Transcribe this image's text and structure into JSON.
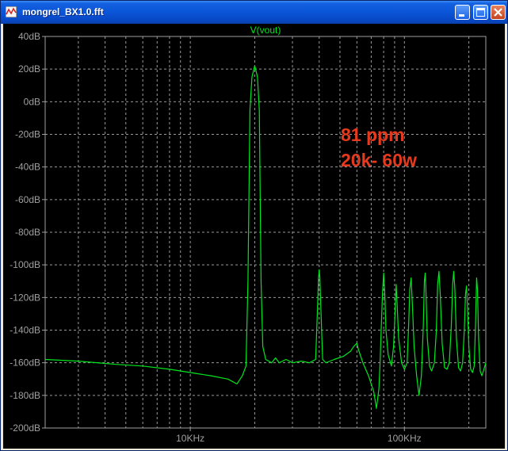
{
  "window": {
    "title": "mongrel_BX1.0.fft",
    "buttons": [
      "minimize",
      "maximize",
      "close"
    ]
  },
  "colors": {
    "trace": "#00e61e",
    "axis": "#a0a0a0",
    "grid": "#9a9a9a",
    "annotation": "#e53a1e",
    "background": "#000000"
  },
  "annotation": {
    "line1": "81 ppm",
    "line2": "20k- 60w"
  },
  "chart_data": {
    "type": "line",
    "title": "V(vout)",
    "x_scale": "log",
    "xlim": [
      2100,
      240000
    ],
    "ylim": [
      -200,
      40
    ],
    "y_ticks": [
      {
        "value": 40,
        "label": "40dB"
      },
      {
        "value": 20,
        "label": "20dB"
      },
      {
        "value": 0,
        "label": "0dB"
      },
      {
        "value": -20,
        "label": "-20dB"
      },
      {
        "value": -40,
        "label": "-40dB"
      },
      {
        "value": -60,
        "label": "-60dB"
      },
      {
        "value": -80,
        "label": "-80dB"
      },
      {
        "value": -100,
        "label": "-100dB"
      },
      {
        "value": -120,
        "label": "-120dB"
      },
      {
        "value": -140,
        "label": "-140dB"
      },
      {
        "value": -160,
        "label": "-160dB"
      },
      {
        "value": -180,
        "label": "-180dB"
      },
      {
        "value": -200,
        "label": "-200dB"
      }
    ],
    "x_ticks": [
      {
        "value": 10000,
        "label": "10KHz"
      },
      {
        "value": 100000,
        "label": "100KHz"
      }
    ],
    "grid": true,
    "series": [
      {
        "name": "V(vout)",
        "points": [
          [
            2100,
            -158
          ],
          [
            3000,
            -159
          ],
          [
            4500,
            -161
          ],
          [
            6000,
            -162
          ],
          [
            8000,
            -164
          ],
          [
            10000,
            -166
          ],
          [
            12500,
            -168
          ],
          [
            15000,
            -170
          ],
          [
            16500,
            -173
          ],
          [
            17500,
            -168
          ],
          [
            18200,
            -162
          ],
          [
            18600,
            -110
          ],
          [
            19000,
            -5
          ],
          [
            19400,
            15
          ],
          [
            19800,
            20
          ],
          [
            20000,
            22
          ],
          [
            20200,
            20
          ],
          [
            20600,
            15
          ],
          [
            21000,
            -5
          ],
          [
            21400,
            -110
          ],
          [
            21800,
            -150
          ],
          [
            22500,
            -158
          ],
          [
            24000,
            -160
          ],
          [
            25000,
            -157
          ],
          [
            26000,
            -160
          ],
          [
            28000,
            -158
          ],
          [
            30000,
            -160
          ],
          [
            33000,
            -159
          ],
          [
            36000,
            -160
          ],
          [
            38500,
            -158
          ],
          [
            39200,
            -130
          ],
          [
            39700,
            -108
          ],
          [
            40000,
            -103
          ],
          [
            40300,
            -108
          ],
          [
            40800,
            -130
          ],
          [
            41500,
            -158
          ],
          [
            43000,
            -160
          ],
          [
            47000,
            -158
          ],
          [
            52000,
            -156
          ],
          [
            56000,
            -153
          ],
          [
            58000,
            -150
          ],
          [
            60000,
            -148
          ],
          [
            61000,
            -152
          ],
          [
            64000,
            -160
          ],
          [
            68000,
            -168
          ],
          [
            72000,
            -178
          ],
          [
            74000,
            -188
          ],
          [
            76000,
            -176
          ],
          [
            77000,
            -160
          ],
          [
            78000,
            -138
          ],
          [
            79000,
            -118
          ],
          [
            80000,
            -105
          ],
          [
            81000,
            -118
          ],
          [
            82000,
            -140
          ],
          [
            84000,
            -155
          ],
          [
            87000,
            -162
          ],
          [
            89000,
            -150
          ],
          [
            90500,
            -128
          ],
          [
            91500,
            -112
          ],
          [
            92500,
            -124
          ],
          [
            94000,
            -145
          ],
          [
            97000,
            -160
          ],
          [
            100000,
            -164
          ],
          [
            103000,
            -160
          ],
          [
            104500,
            -140
          ],
          [
            106000,
            -115
          ],
          [
            107500,
            -108
          ],
          [
            109000,
            -125
          ],
          [
            111000,
            -150
          ],
          [
            114000,
            -168
          ],
          [
            117000,
            -180
          ],
          [
            120000,
            -168
          ],
          [
            122500,
            -138
          ],
          [
            124000,
            -110
          ],
          [
            125000,
            -105
          ],
          [
            126000,
            -115
          ],
          [
            128000,
            -145
          ],
          [
            131000,
            -162
          ],
          [
            134000,
            -165
          ],
          [
            138000,
            -160
          ],
          [
            141000,
            -140
          ],
          [
            143000,
            -112
          ],
          [
            145000,
            -104
          ],
          [
            147000,
            -118
          ],
          [
            150000,
            -148
          ],
          [
            154000,
            -163
          ],
          [
            158000,
            -164
          ],
          [
            162000,
            -160
          ],
          [
            165500,
            -138
          ],
          [
            168000,
            -112
          ],
          [
            170000,
            -104
          ],
          [
            172000,
            -114
          ],
          [
            175000,
            -145
          ],
          [
            179000,
            -163
          ],
          [
            183000,
            -165
          ],
          [
            187000,
            -160
          ],
          [
            190500,
            -140
          ],
          [
            193000,
            -118
          ],
          [
            195000,
            -113
          ],
          [
            197000,
            -125
          ],
          [
            200000,
            -150
          ],
          [
            204000,
            -164
          ],
          [
            208000,
            -166
          ],
          [
            212000,
            -162
          ],
          [
            215000,
            -135
          ],
          [
            217500,
            -108
          ],
          [
            219500,
            -115
          ],
          [
            222000,
            -145
          ],
          [
            226000,
            -165
          ],
          [
            230000,
            -168
          ],
          [
            234000,
            -165
          ],
          [
            240000,
            -160
          ]
        ]
      }
    ]
  }
}
